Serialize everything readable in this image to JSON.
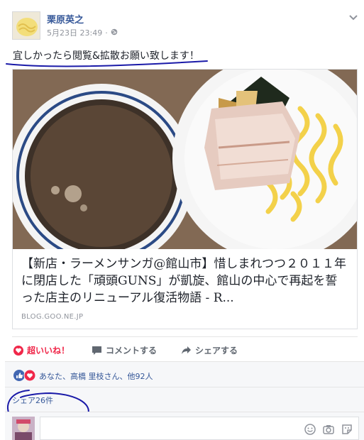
{
  "post": {
    "author": "栗原英之",
    "timestamp": "5月23日 23:49",
    "separator": "·",
    "audience_icon": "globe-icon",
    "text": "宜しかったら閲覧&拡散お願い致します！"
  },
  "link_card": {
    "title": "【新店・ラーメンサンガ@館山市】惜しまれつつ２０１１年に閉店した「頑頭GUNS」が凱旋、館山の中心で再起を誓った店主のリニューアル復活物語 - R...",
    "domain": "BLOG.GOO.NE.JP"
  },
  "actions": {
    "like": "超いいね！",
    "comment": "コメントする",
    "share": "シェアする"
  },
  "reactions": {
    "summary": "あなた、高橋 里枝さん、他92人",
    "icons": [
      "like-icon",
      "love-icon"
    ]
  },
  "shares": {
    "label": "シェア26件"
  },
  "comment_tools": [
    "smiley-icon",
    "camera-icon",
    "sticker-icon"
  ],
  "colors": {
    "link": "#365899",
    "love": "#f0284a",
    "like": "#4267b2",
    "muted": "#90949c",
    "annotation_pen": "#1a1aa8"
  }
}
